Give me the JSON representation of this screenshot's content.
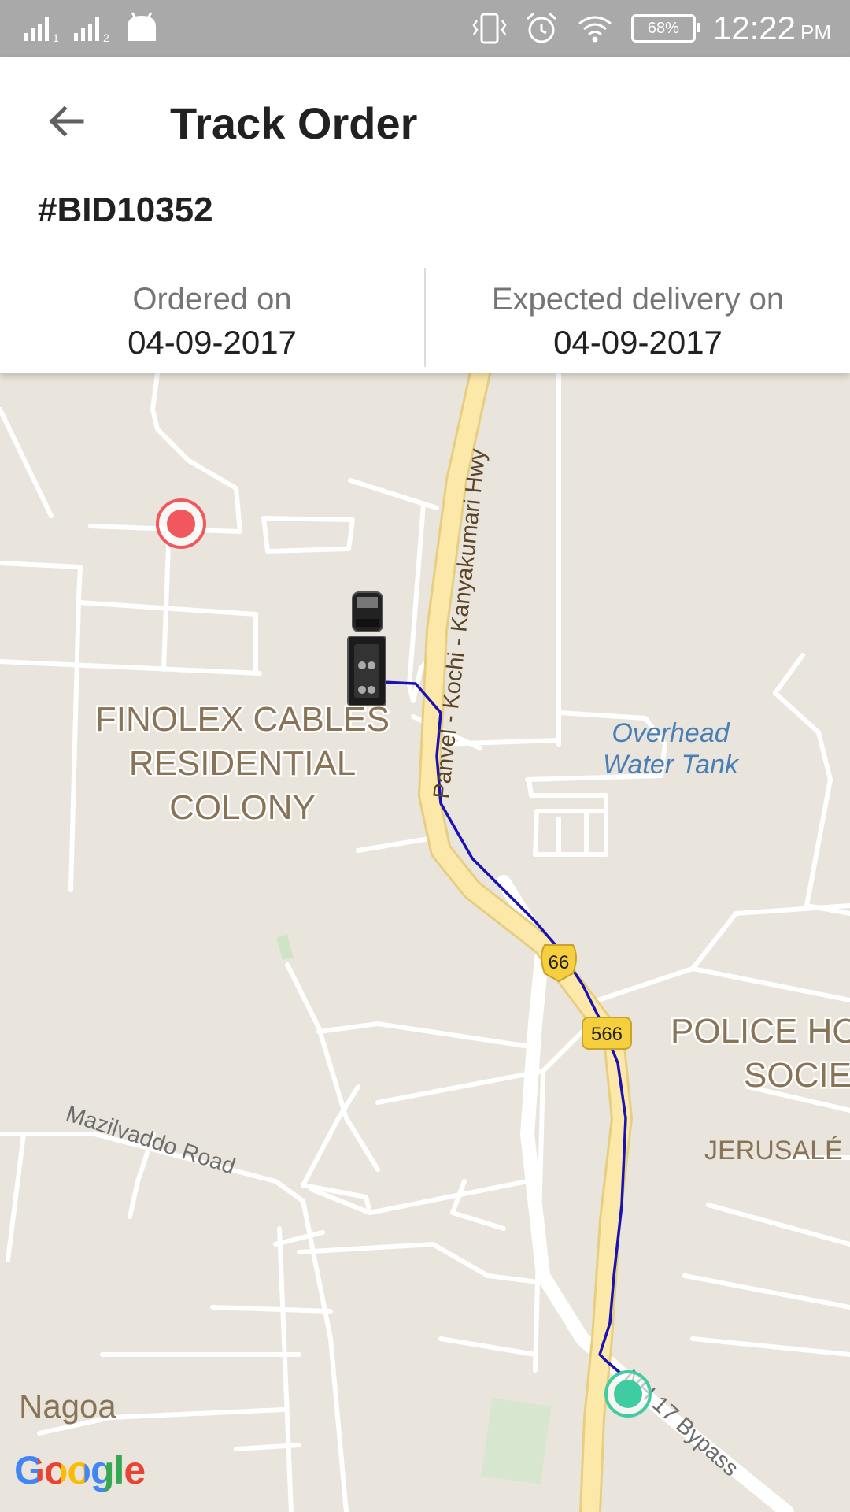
{
  "status_bar": {
    "sim1": "1",
    "sim2": "2",
    "battery": "68%",
    "time": "12:22",
    "ampm": "PM",
    "icons": [
      "signal-icon",
      "android-icon",
      "vibrate-icon",
      "alarm-icon",
      "wifi-icon",
      "battery-icon"
    ]
  },
  "header": {
    "title": "Track Order",
    "back_icon": "arrow-left-icon"
  },
  "order": {
    "id": "#BID10352",
    "ordered_label": "Ordered on",
    "ordered_date": "04-09-2017",
    "expected_label": "Expected delivery on",
    "expected_date": "04-09-2017"
  },
  "map": {
    "labels": {
      "highway": "Panvel - Kochi - Kanyakumari Hwy",
      "colony_1": "FINOLEX CABLES",
      "colony_2": "RESIDENTIAL",
      "colony_3": "COLONY",
      "tank_1": "Overhead",
      "tank_2": "Water Tank",
      "road_shield_1": "66",
      "road_shield_2": "566",
      "police_1": "POLICE HO",
      "police_2": "SOCIET",
      "jerusalem": "JERUSALÉ",
      "mazil": "Mazilvaddo Road",
      "bypass": "NH 17 Bypass",
      "nagoa": "Nagoa"
    },
    "attribution": "Google",
    "colors": {
      "land": "#e9e5dc",
      "road": "#ffffff",
      "highway": "#fce8a8",
      "route": "#1a12b5",
      "destination": "#f0585e",
      "origin": "#3fcca0",
      "label": "#8a7457",
      "water_label": "#4a7fb5"
    }
  }
}
